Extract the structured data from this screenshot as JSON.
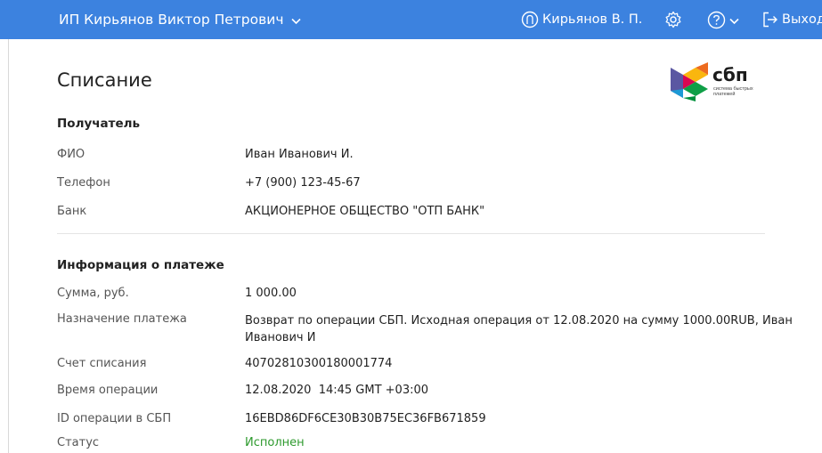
{
  "header": {
    "org_name": "ИП Кирьянов Виктор Петрович",
    "user_name": "Кирьянов В. П.",
    "logout_label": "Выход"
  },
  "page": {
    "title": "Списание"
  },
  "logo": {
    "name": "сбп",
    "subtitle": "система быстрых платежей"
  },
  "recipient": {
    "heading": "Получатель",
    "rows": [
      {
        "label": "ФИО",
        "value": "Иван Иванович И."
      },
      {
        "label": "Телефон",
        "value": "+7 (900) 123-45-67"
      },
      {
        "label": "Банк",
        "value": "АКЦИОНЕРНОЕ ОБЩЕСТВО \"ОТП БАНК\""
      }
    ]
  },
  "payment": {
    "heading": "Информация о платеже",
    "rows": [
      {
        "label": "Сумма, руб.",
        "value": "1 000.00"
      },
      {
        "label": "Назначение платежа",
        "value": "Возврат по операции СБП. Исходная операция от 12.08.2020 на сумму 1000.00RUB, Иван Иванович И"
      },
      {
        "label": "Счет списания",
        "value": "40702810300180001774"
      },
      {
        "label": "Время операции",
        "value": "12.08.2020  14:45 GMT +03:00"
      },
      {
        "label": "ID операции в СБП",
        "value": "16EBD86DF6CE30B30B75EC36FB671859"
      },
      {
        "label": "Статус",
        "value": "Исполнен"
      }
    ]
  },
  "colors": {
    "header_bg": "#3c82df",
    "status_success": "#2e9a2e"
  }
}
